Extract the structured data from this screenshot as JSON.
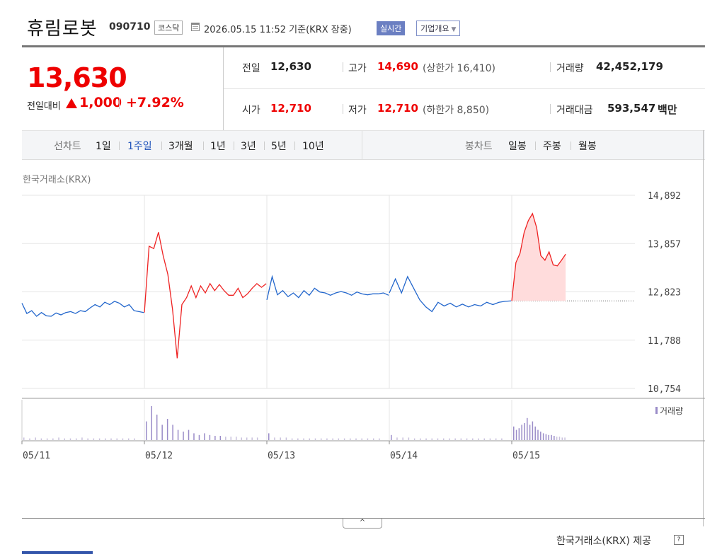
{
  "header": {
    "name": "휴림로봇",
    "code": "090710",
    "market": "코스닥",
    "date": "2026.05.15 11:52",
    "basis": "기준(KRX 장중)",
    "realtime": "실시간",
    "company_overview": "기업개요"
  },
  "quote": {
    "price": "13,630",
    "change_label": "전일대비",
    "change": "1,000",
    "change_pct": "+7.92%",
    "prev_label": "전일",
    "prev": "12,630",
    "high_label": "고가",
    "high": "14,690",
    "upper_limit": "(상한가 16,410)",
    "volume_label": "거래량",
    "volume": "42,452,179",
    "open_label": "시가",
    "open": "12,710",
    "low_label": "저가",
    "low": "12,710",
    "lower_limit": "(하한가 8,850)",
    "amount_label": "거래대금",
    "amount": "593,547",
    "amount_unit": "백만"
  },
  "tabs": {
    "line_label": "선차트",
    "line_items": [
      "1일",
      "1주일",
      "3개월",
      "1년",
      "3년",
      "5년",
      "10년"
    ],
    "selected": "1주일",
    "candle_label": "봉차트",
    "candle_items": [
      "일봉",
      "주봉",
      "월봉"
    ]
  },
  "source_top": "한국거래소(KRX)",
  "footer": {
    "provider": "한국거래소(KRX) 제공",
    "help": "?",
    "collapse": "^"
  },
  "colors": {
    "up": "#ee2222",
    "down": "#2266cc",
    "volume": "#9a8cc8"
  },
  "chart_data": {
    "type": "line",
    "title": "",
    "ylim": [
      10754,
      14892
    ],
    "y_ticks": [
      "14,892",
      "13,857",
      "12,823",
      "11,788",
      "10,754"
    ],
    "x_ticks": [
      "05/11",
      "05/12",
      "05/13",
      "05/14",
      "05/15"
    ],
    "reference_price": 12630,
    "volume_legend": "거래량",
    "series": [
      {
        "day": "05/11",
        "color": "down",
        "points": [
          12580,
          12360,
          12420,
          12300,
          12380,
          12310,
          12300,
          12370,
          12330,
          12380,
          12400,
          12360,
          12420,
          12400,
          12480,
          12550,
          12500,
          12600,
          12550,
          12620,
          12580,
          12500,
          12550,
          12420,
          12400,
          12380
        ]
      },
      {
        "day": "05/12",
        "color": "up",
        "points": [
          12380,
          13800,
          13750,
          14100,
          13600,
          13200,
          12450,
          11400,
          12550,
          12700,
          12950,
          12700,
          12950,
          12800,
          13000,
          12850,
          12980,
          12850,
          12750,
          12750,
          12900,
          12700,
          12780,
          12900,
          13000,
          12920,
          13000
        ]
      },
      {
        "day": "05/13",
        "color": "down",
        "points": [
          12650,
          13150,
          12760,
          12850,
          12720,
          12800,
          12700,
          12850,
          12750,
          12900,
          12820,
          12800,
          12750,
          12800,
          12830,
          12800,
          12750,
          12820,
          12780,
          12760,
          12780,
          12780,
          12800,
          12750
        ]
      },
      {
        "day": "05/14",
        "color": "down",
        "points": [
          12800,
          13100,
          12800,
          13150,
          12900,
          12650,
          12500,
          12400,
          12600,
          12520,
          12580,
          12500,
          12560,
          12500,
          12550,
          12520,
          12600,
          12550,
          12600,
          12620,
          12630
        ]
      },
      {
        "day": "05/15",
        "color": "up",
        "points": [
          12630,
          13450,
          13650,
          14100,
          14350,
          14500,
          14200,
          13600,
          13500,
          13680,
          13400,
          13380,
          13500,
          13630
        ]
      }
    ],
    "volume": [
      {
        "day": "05/11",
        "bars": [
          3,
          2,
          3,
          2,
          2,
          2,
          3,
          2,
          2,
          2,
          3,
          2,
          2,
          2,
          2,
          2,
          2,
          2,
          2,
          2
        ]
      },
      {
        "day": "05/12",
        "bars": [
          22,
          40,
          30,
          18,
          25,
          18,
          12,
          10,
          12,
          8,
          6,
          8,
          6,
          5,
          5,
          4,
          4,
          4,
          3,
          3,
          3,
          3
        ]
      },
      {
        "day": "05/13",
        "bars": [
          8,
          3,
          3,
          3,
          2,
          2,
          2,
          2,
          2,
          2,
          2,
          2,
          2,
          2,
          2,
          2,
          2,
          2,
          2,
          2
        ]
      },
      {
        "day": "05/14",
        "bars": [
          6,
          3,
          3,
          3,
          2,
          2,
          2,
          2,
          2,
          2,
          2,
          2,
          2,
          2,
          2,
          2,
          2,
          2,
          2,
          2
        ]
      },
      {
        "day": "05/15",
        "bars": [
          16,
          12,
          14,
          18,
          20,
          26,
          18,
          22,
          16,
          12,
          10,
          8,
          7,
          6,
          6,
          5,
          4,
          4,
          3,
          3
        ]
      }
    ]
  }
}
